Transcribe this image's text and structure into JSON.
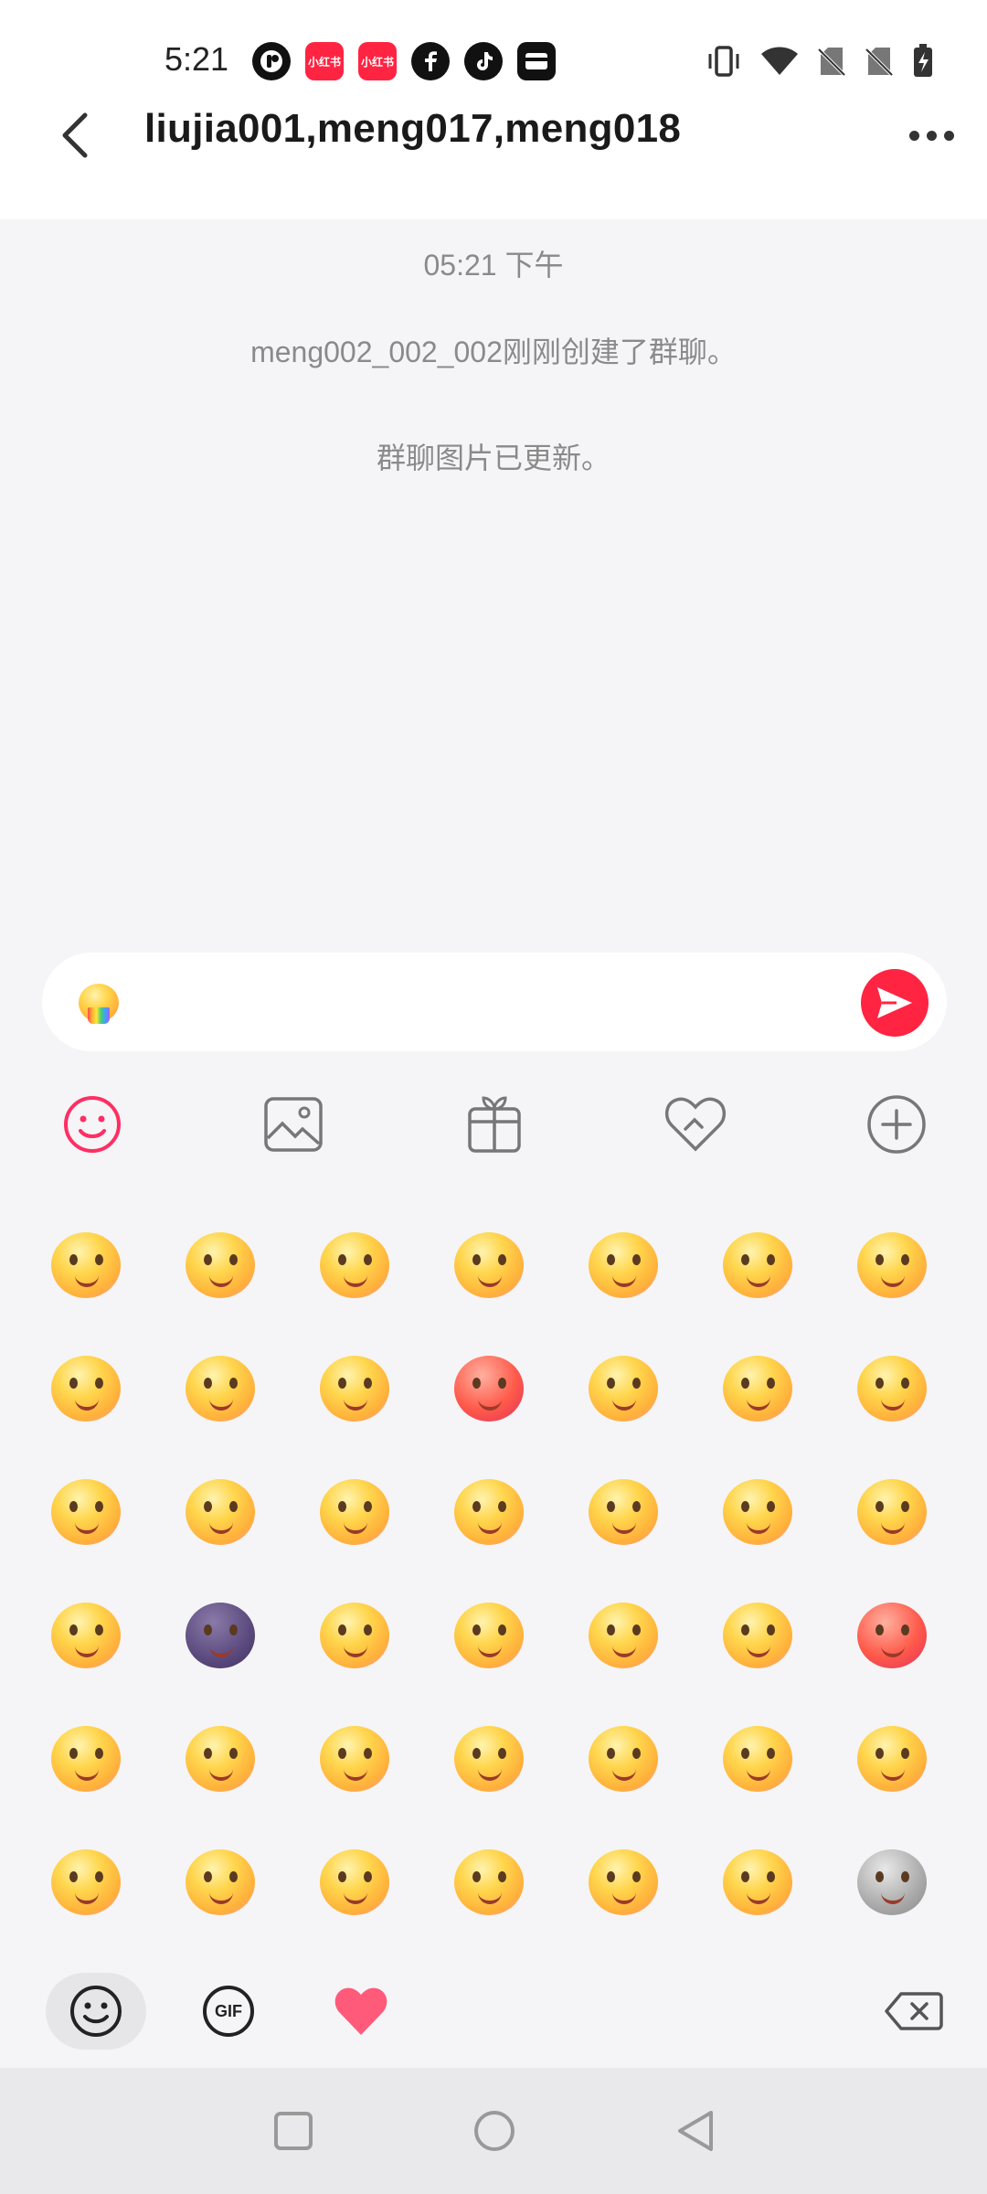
{
  "status_bar": {
    "time": "5:21",
    "app_icons": [
      "lemon8-icon",
      "xiaohongshu-icon",
      "xiaohongshu-icon",
      "facebook-icon",
      "tiktok-icon",
      "wallet-icon"
    ],
    "xhs_label": "小红书",
    "right_icons": [
      "vibrate-icon",
      "wifi-icon",
      "no-sim-icon",
      "no-sim-icon",
      "battery-charging-icon"
    ]
  },
  "header": {
    "title": "liujia001,meng017,meng018"
  },
  "messages": {
    "timestamp": "05:21 下午",
    "items": [
      "meng002_002_002刚刚创建了群聊。",
      "群聊图片已更新。"
    ]
  },
  "input": {
    "value_icon": "rainbow-vomit-emoji"
  },
  "toolbar": [
    "emoji-icon",
    "image-icon",
    "gift-icon",
    "heart-icon",
    "plus-icon"
  ],
  "emoji_grid": {
    "rows": [
      [
        "smile",
        "grin",
        "cheeky",
        "smirk",
        "slipper-hit",
        "pleading",
        "shocked"
      ],
      [
        "rainbow-cry",
        "facepalm-cry",
        "sweat-laugh",
        "angry",
        "confused",
        "eye-roll",
        "laugh-tears"
      ],
      [
        "nerd-cry",
        "sigh",
        "happy-hands",
        "scream",
        "cover-face",
        "fist",
        "star-hit"
      ],
      [
        "pray",
        "dark-face",
        "egg-head",
        "shush",
        "giggle",
        "vomit",
        "fire-angry"
      ],
      [
        "dizzy",
        "kiss",
        "crying",
        "love",
        "rofl",
        "tape-mouth",
        "wink"
      ],
      [
        "cheeky-left",
        "frown",
        "calm",
        "worried",
        "tears",
        "smug",
        "grey-sad"
      ]
    ]
  },
  "bottom_tabs": [
    "emoji-tab-icon",
    "gif-tab-icon",
    "heart-tab-icon",
    "backspace-icon"
  ],
  "gif_label": "GIF",
  "colors": {
    "accent": "#ff2442",
    "background": "#f5f5f7",
    "system_text": "#8a8a8a"
  }
}
